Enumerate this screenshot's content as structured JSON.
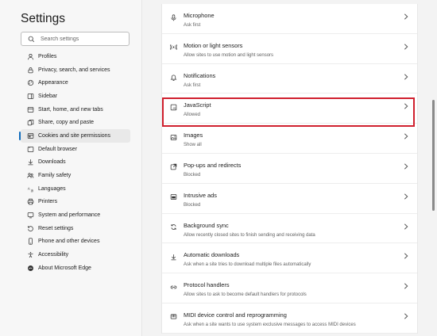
{
  "sidebar": {
    "title": "Settings",
    "search_placeholder": "Search settings",
    "items": [
      {
        "label": "Profiles",
        "icon": "profile-icon",
        "active": false
      },
      {
        "label": "Privacy, search, and services",
        "icon": "lock-icon",
        "active": false
      },
      {
        "label": "Appearance",
        "icon": "appearance-icon",
        "active": false
      },
      {
        "label": "Sidebar",
        "icon": "sidebar-icon",
        "active": false
      },
      {
        "label": "Start, home, and new tabs",
        "icon": "home-icon",
        "active": false
      },
      {
        "label": "Share, copy and paste",
        "icon": "share-icon",
        "active": false
      },
      {
        "label": "Cookies and site permissions",
        "icon": "cookies-icon",
        "active": true
      },
      {
        "label": "Default browser",
        "icon": "browser-icon",
        "active": false
      },
      {
        "label": "Downloads",
        "icon": "download-icon",
        "active": false
      },
      {
        "label": "Family safety",
        "icon": "family-icon",
        "active": false
      },
      {
        "label": "Languages",
        "icon": "languages-icon",
        "active": false
      },
      {
        "label": "Printers",
        "icon": "printer-icon",
        "active": false
      },
      {
        "label": "System and performance",
        "icon": "system-icon",
        "active": false
      },
      {
        "label": "Reset settings",
        "icon": "reset-icon",
        "active": false
      },
      {
        "label": "Phone and other devices",
        "icon": "phone-icon",
        "active": false
      },
      {
        "label": "Accessibility",
        "icon": "accessibility-icon",
        "active": false
      },
      {
        "label": "About Microsoft Edge",
        "icon": "edge-icon",
        "active": false
      }
    ]
  },
  "permissions": [
    {
      "title": "Microphone",
      "subtitle": "Ask first",
      "icon": "microphone-icon"
    },
    {
      "title": "Motion or light sensors",
      "subtitle": "Allow sites to use motion and light sensors",
      "icon": "sensor-icon"
    },
    {
      "title": "Notifications",
      "subtitle": "Ask first",
      "icon": "bell-icon"
    },
    {
      "title": "JavaScript",
      "subtitle": "Allowed",
      "icon": "javascript-icon",
      "highlighted": true
    },
    {
      "title": "Images",
      "subtitle": "Show all",
      "icon": "image-icon"
    },
    {
      "title": "Pop-ups and redirects",
      "subtitle": "Blocked",
      "icon": "popup-icon"
    },
    {
      "title": "Intrusive ads",
      "subtitle": "Blocked",
      "icon": "ads-icon"
    },
    {
      "title": "Background sync",
      "subtitle": "Allow recently closed sites to finish sending and receiving data",
      "icon": "sync-icon"
    },
    {
      "title": "Automatic downloads",
      "subtitle": "Ask when a site tries to download multiple files automatically",
      "icon": "download-icon"
    },
    {
      "title": "Protocol handlers",
      "subtitle": "Allow sites to ask to become default handlers for protocols",
      "icon": "link-icon"
    },
    {
      "title": "MIDI device control and reprogramming",
      "subtitle": "Ask when a site wants to use system exclusive messages to access MIDI devices",
      "icon": "midi-icon"
    }
  ],
  "colors": {
    "accent": "#0f6cbd",
    "highlight": "#d0202e"
  }
}
